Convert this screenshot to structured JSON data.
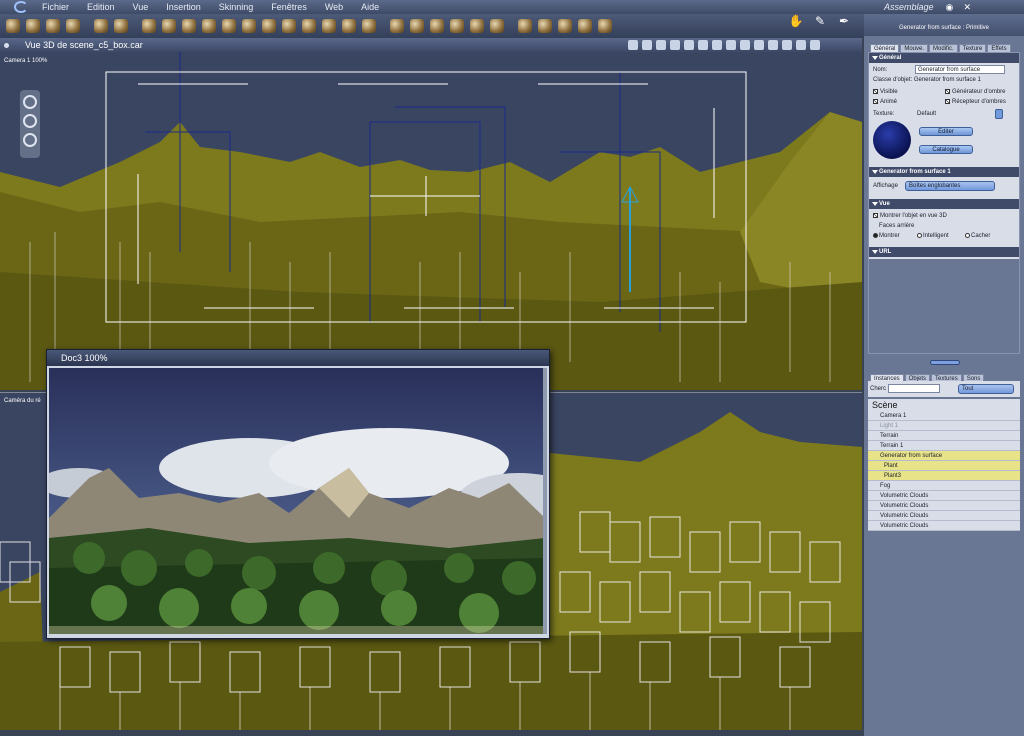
{
  "menubar": {
    "items": [
      "Fichier",
      "Edition",
      "Vue",
      "Insertion",
      "Skinning",
      "Fenêtres",
      "Web",
      "Aide"
    ],
    "workspace": "Assemblage"
  },
  "viewport_top": {
    "title": "Vue 3D de scene_c5_box.car",
    "camera_label": "Camera 1 100%"
  },
  "viewport_bottom": {
    "camera_label": "Caméra du ré"
  },
  "doc_window": {
    "title": "Doc3 100%"
  },
  "panel": {
    "header": "Generator from surface : Primitive",
    "tabs": [
      "Général",
      "Mouve.",
      "Modific.",
      "Texture",
      "Effets"
    ],
    "section_general": "Général",
    "nom_label": "Nom:",
    "nom_value": "Generator from surface",
    "classe": "Classe d'objet: Generator from surface 1",
    "visible": "Visible",
    "anime": "Animé",
    "gen_ombre": "Générateur d'ombre",
    "rec_ombre": "Récepteur d'ombres",
    "texture_label": "Texture:",
    "texture_value": "Default",
    "editer": "Editer",
    "catalogue": "Catalogue",
    "section_gen": "Generator from surface 1",
    "affichage_label": "Affichage",
    "affichage_value": "Boîtes englobantes",
    "section_vue": "Vue",
    "montrer_objet": "Montrer l'objet en vue 3D",
    "faces_arriere": "Faces arrière",
    "radio_montrer": "Montrer",
    "radio_intelligent": "Intelligent",
    "radio_cacher": "Cacher",
    "section_url": "URL"
  },
  "scene_panel": {
    "tabs": [
      "Instances",
      "Objets",
      "Textures",
      "Sons"
    ],
    "search_label": "Cherc",
    "filter_value": "Tout",
    "scene_title": "Scène",
    "items": [
      {
        "label": "Camera 1",
        "style": "normal"
      },
      {
        "label": "Light 1",
        "style": "dim"
      },
      {
        "label": "Terrain",
        "style": "normal"
      },
      {
        "label": "Terrain 1",
        "style": "normal"
      },
      {
        "label": "Generator from surface",
        "style": "hl"
      },
      {
        "label": "Plant",
        "style": "hl-sub"
      },
      {
        "label": "Plant3",
        "style": "hl-sub"
      },
      {
        "label": "Fog",
        "style": "normal"
      },
      {
        "label": "Volumetric Clouds",
        "style": "normal"
      },
      {
        "label": "Volumetric Clouds",
        "style": "normal"
      },
      {
        "label": "Volumetric Clouds",
        "style": "normal"
      },
      {
        "label": "Volumetric Clouds",
        "style": "normal"
      }
    ]
  },
  "colors": {
    "terrain": "#7d7a1e",
    "selection_highlight": "#e8e289",
    "accent_button": "#6f95d6"
  }
}
